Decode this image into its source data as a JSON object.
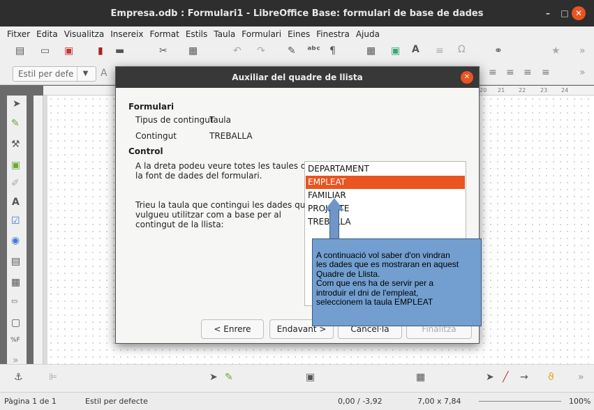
{
  "window": {
    "title": "Empresa.odb : Formulari1 - LibreOffice Base: formulari de base de dades",
    "minimize": "–",
    "maximize": "□",
    "close": "✕"
  },
  "menubar": [
    "Fitxer",
    "Edita",
    "Visualitza",
    "Insereix",
    "Format",
    "Estils",
    "Taula",
    "Formulari",
    "Eines",
    "Finestra",
    "Ajuda"
  ],
  "toolbar": {
    "style_value": "Estil per defe"
  },
  "ruler": {
    "right_ticks": [
      "20",
      "21",
      "22",
      "23",
      "24"
    ]
  },
  "dialog": {
    "title": "Auxiliar del quadre de llista",
    "section_form": "Formulari",
    "content_type_label": "Tipus de contingut",
    "content_type_value": "Taula",
    "content_label": "Contingut",
    "content_value": "TREBALLA",
    "section_control": "Control",
    "info_line1": "A la dreta podeu veure totes les taules de",
    "info_line2": "la font de dades del formulari.",
    "choose_line1": "Trieu la taula que contingui les dades que",
    "choose_line2": "vulgueu utilitzar com a base per al",
    "choose_line3": "contingut de la llista:",
    "tables": [
      "DEPARTAMENT",
      "EMPLEAT",
      "FAMILIAR",
      "PROJECTE",
      "TREBALLA"
    ],
    "selected_table": "EMPLEAT",
    "buttons": {
      "back": "< Enrere",
      "next": "Endavant >",
      "cancel": "Cancel·la",
      "finish": "Finalitza"
    }
  },
  "callout": {
    "lines": [
      "A continuació vol saber d'on vindran",
      "les dades que es mostraran en aquest",
      "Quadre de Llista.",
      "Com que ens ha de servir per a",
      "introduir el dni de l'empleat,",
      "seleccionem la taula EMPLEAT"
    ]
  },
  "statusbar": {
    "page": "Pàgina 1 de 1",
    "style": "Estil per defecte",
    "position": "0,00 / -3,92",
    "size": "7,00 x 7,84",
    "zoom": "100%"
  },
  "colors": {
    "accent": "#e95420",
    "callout": "#729fcf"
  }
}
